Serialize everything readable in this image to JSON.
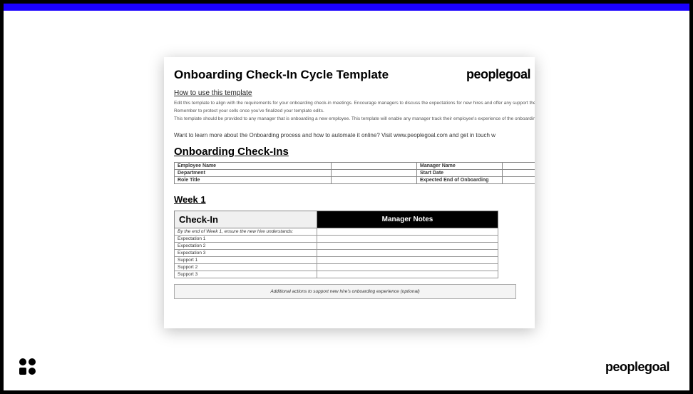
{
  "doc": {
    "title": "Onboarding Check-In Cycle Template",
    "brand": {
      "part1": "people",
      "part2": "goal"
    },
    "howTo": "How to use this template",
    "intro1": "Edit this template to align with the requirements for your onboarding check-in meetings. Encourage managers to discuss the expectations for new hires and offer any support they",
    "intro2": "Remember to protect your cells once you've finalized your template edits.",
    "intro3": "This template should be provided to any manager that is onboarding a new employee. This template will enable any manager track their employee's experience of the onboarding p",
    "learnMore": "Want to learn more about the Onboarding process and how to automate it online? Visit www.peoplegoal.com and get in touch w",
    "checkinsHeading": "Onboarding Check-Ins",
    "infoFields": {
      "empName": "Employee Name",
      "mgrName": "Manager Name",
      "dept": "Department",
      "startDate": "Start Date",
      "role": "Role Title",
      "endOnb": "Expected End of Onboarding"
    },
    "week1": "Week 1",
    "checkinHead": "Check-In",
    "notesHead": "Manager Notes",
    "instr": "By the end of Week 1, ensure the new hire understands:",
    "rows": [
      "Expectation 1",
      "Expectation 2",
      "Expectation 3",
      "Support 1",
      "Support 2",
      "Support 3"
    ],
    "additional": "Additional actions to support new hire's onboarding experience (optional)"
  },
  "footer": {
    "brand": {
      "part1": "people",
      "part2": "goal"
    }
  }
}
